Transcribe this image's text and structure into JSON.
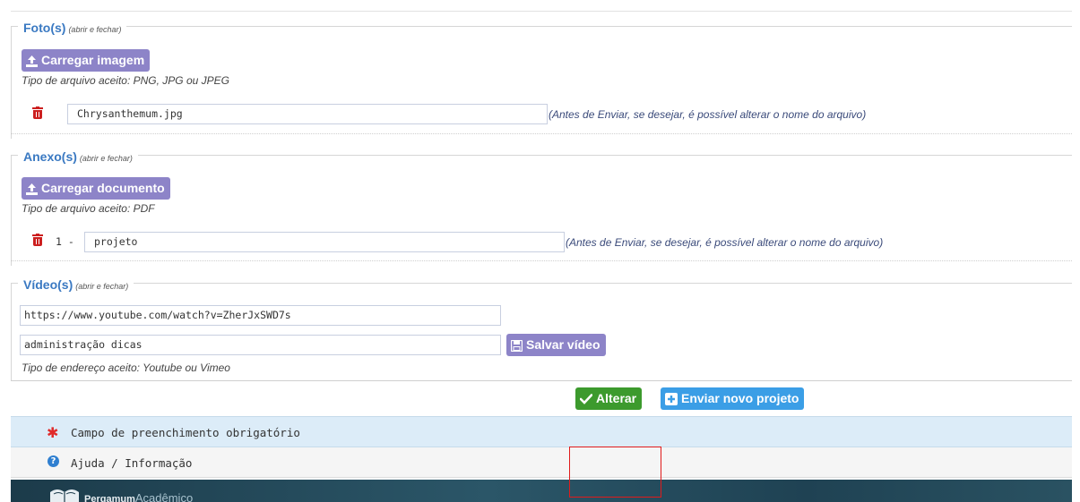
{
  "fotos": {
    "title": "Foto(s)",
    "toggle_hint": "(abrir e fechar)",
    "upload_button": "Carregar imagem",
    "accepted_types": "Tipo de arquivo aceito: PNG, JPG ou JPEG",
    "file_name_value": "Chrysanthemum.jpg",
    "rename_hint": "(Antes de Enviar, se desejar, é possível alterar o nome do arquivo)"
  },
  "anexos": {
    "title": "Anexo(s)",
    "toggle_hint": "(abrir e fechar)",
    "upload_button": "Carregar documento",
    "accepted_types": "Tipo de arquivo aceito: PDF",
    "item_index": "1 -",
    "file_name_value": "projeto",
    "rename_hint": "(Antes de Enviar, se desejar, é possível alterar o nome do arquivo)"
  },
  "videos": {
    "title": "Vídeo(s)",
    "toggle_hint": "(abrir e fechar)",
    "url_value": "https://www.youtube.com/watch?v=ZherJxSWD7s",
    "description_value": "administração dicas",
    "save_button": "Salvar vídeo",
    "accepted_types": "Tipo de endereço aceito: Youtube ou Vimeo"
  },
  "actions": {
    "alter_button": "Alterar",
    "new_project_button": "Enviar novo projeto"
  },
  "info": {
    "required_note": "Campo de preenchimento obrigatório",
    "help_label": "Ajuda / Informação"
  },
  "footer": {
    "brand_bold": "Pergamum",
    "brand_light": "Acadêmico"
  },
  "colors": {
    "legend_blue": "#3a79c2",
    "purple_button": "#8d84c8",
    "green_button": "#3c9a2d",
    "blue_button": "#3b9ee6",
    "trash_red": "#cc1f1f",
    "highlight_box": "#e01b1b"
  }
}
